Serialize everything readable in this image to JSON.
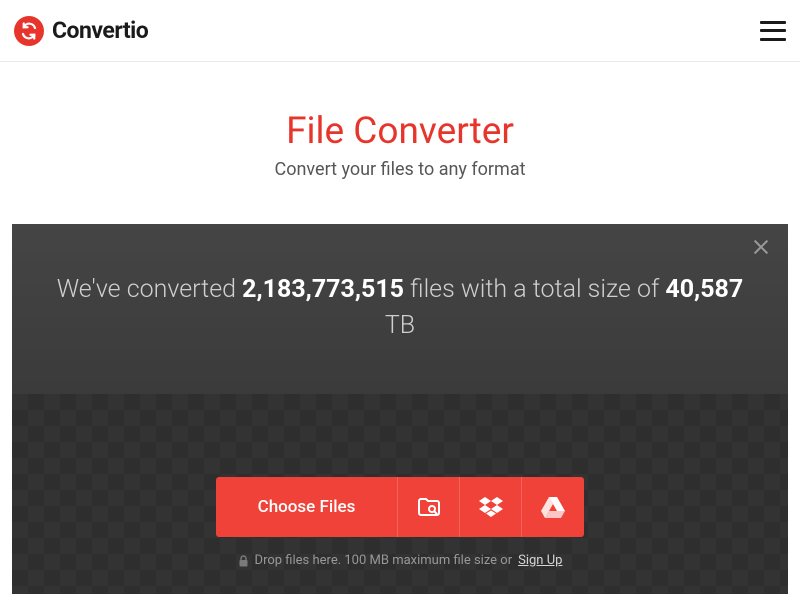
{
  "header": {
    "brand": "Convertio"
  },
  "hero": {
    "title": "File Converter",
    "subtitle": "Convert your files to any format"
  },
  "stats": {
    "prefix": "We've converted ",
    "files_count": "2,183,773,515",
    "mid": " files with a total size of ",
    "size_value": "40,587",
    "size_unit": " TB"
  },
  "uploader": {
    "choose_label": "Choose Files",
    "hint_prefix": "Drop files here. 100 MB maximum file size or ",
    "signup_label": "Sign Up"
  }
}
